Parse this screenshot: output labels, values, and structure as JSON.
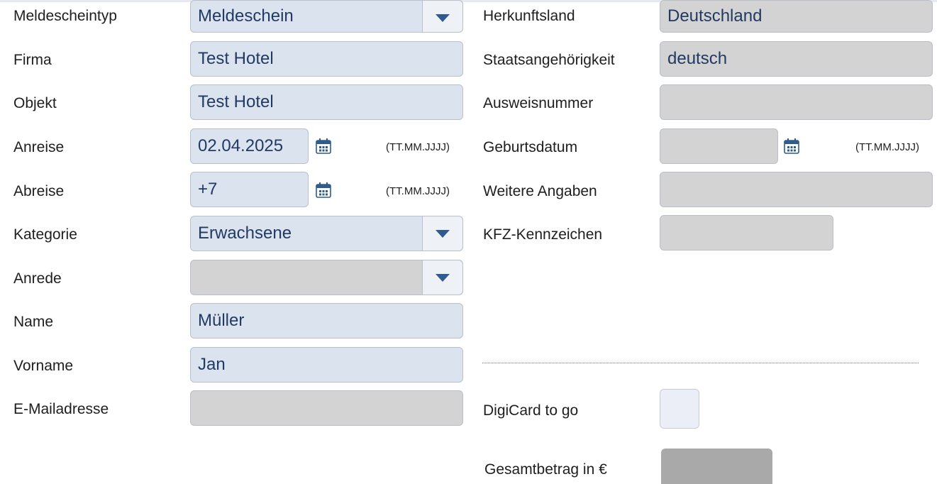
{
  "labels": {
    "meldescheintyp": "Meldescheintyp",
    "firma": "Firma",
    "objekt": "Objekt",
    "anreise": "Anreise",
    "abreise": "Abreise",
    "kategorie": "Kategorie",
    "anrede": "Anrede",
    "name": "Name",
    "vorname": "Vorname",
    "email": "E-Mailadresse",
    "herkunftsland": "Herkunftsland",
    "staatsangehoerigkeit": "Staatsangehörigkeit",
    "ausweisnummer": "Ausweisnummer",
    "geburtsdatum": "Geburtsdatum",
    "weitere_angaben": "Weitere Angaben",
    "kfz": "KFZ-Kennzeichen",
    "digicard": "DigiCard to go",
    "gesamtbetrag": "Gesamtbetrag in €"
  },
  "values": {
    "meldescheintyp": "Meldeschein",
    "firma": "Test Hotel",
    "objekt": "Test Hotel",
    "anreise": "02.04.2025",
    "abreise": "+7",
    "kategorie": "Erwachsene",
    "anrede": "",
    "name": "Müller",
    "vorname": "Jan",
    "email": "",
    "herkunftsland": "Deutschland",
    "staatsangehoerigkeit": "deutsch",
    "ausweisnummer": "",
    "geburtsdatum": "",
    "weitere_angaben": "",
    "kfz": "",
    "gesamtbetrag": ""
  },
  "hints": {
    "date_format": "(TT.MM.JJJJ)"
  },
  "icons": {
    "calendar": "calendar-icon",
    "dropdown": "chevron-down-icon"
  },
  "colors": {
    "field_blue": "#dbe3ef",
    "field_gray": "#d3d3d3",
    "text_value": "#223a63",
    "icon_blue": "#2f5b8f"
  },
  "digicard_checked": false
}
